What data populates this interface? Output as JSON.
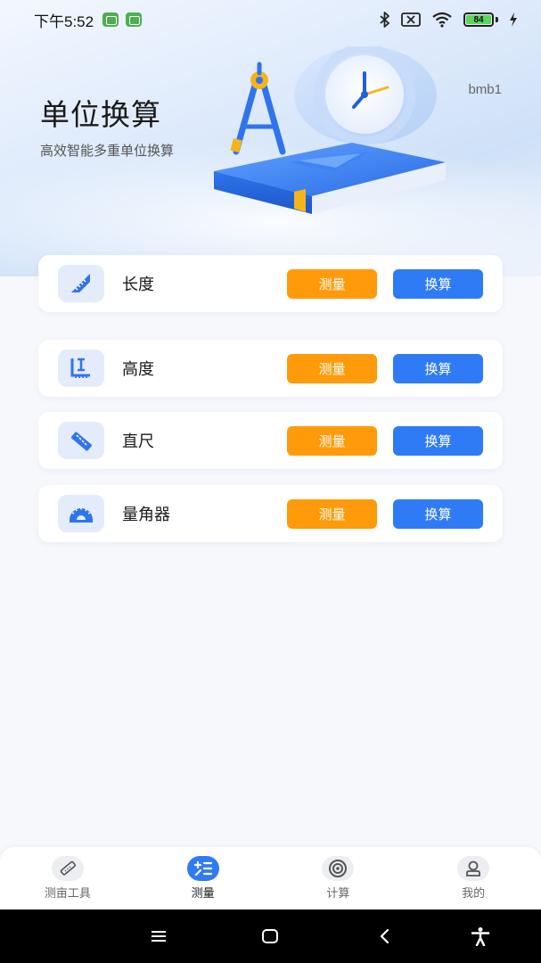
{
  "status_bar": {
    "time": "下午5:52",
    "battery_level": "84"
  },
  "hero": {
    "title": "单位换算",
    "subtitle": "高效智能多重单位换算",
    "user": "bmb1"
  },
  "tools": [
    {
      "label": "长度",
      "icon": "triangle-ruler-icon",
      "measure_label": "测量",
      "convert_label": "换算"
    },
    {
      "label": "高度",
      "icon": "height-ruler-icon",
      "measure_label": "测量",
      "convert_label": "换算"
    },
    {
      "label": "直尺",
      "icon": "straight-ruler-icon",
      "measure_label": "测量",
      "convert_label": "换算"
    },
    {
      "label": "量角器",
      "icon": "protractor-icon",
      "measure_label": "测量",
      "convert_label": "换算"
    }
  ],
  "tab_bar": {
    "tabs": [
      {
        "label": "测亩工具",
        "icon": "ruler-icon",
        "active": false
      },
      {
        "label": "测量",
        "icon": "calculator-icon",
        "active": true
      },
      {
        "label": "计算",
        "icon": "target-icon",
        "active": false
      },
      {
        "label": "我的",
        "icon": "user-icon",
        "active": false
      }
    ]
  },
  "colors": {
    "measure_button": "#ff9a0a",
    "convert_button": "#2f7bf5",
    "active_tab": "#2f7bf5",
    "card_icon_bg": "#e4ecfb"
  }
}
